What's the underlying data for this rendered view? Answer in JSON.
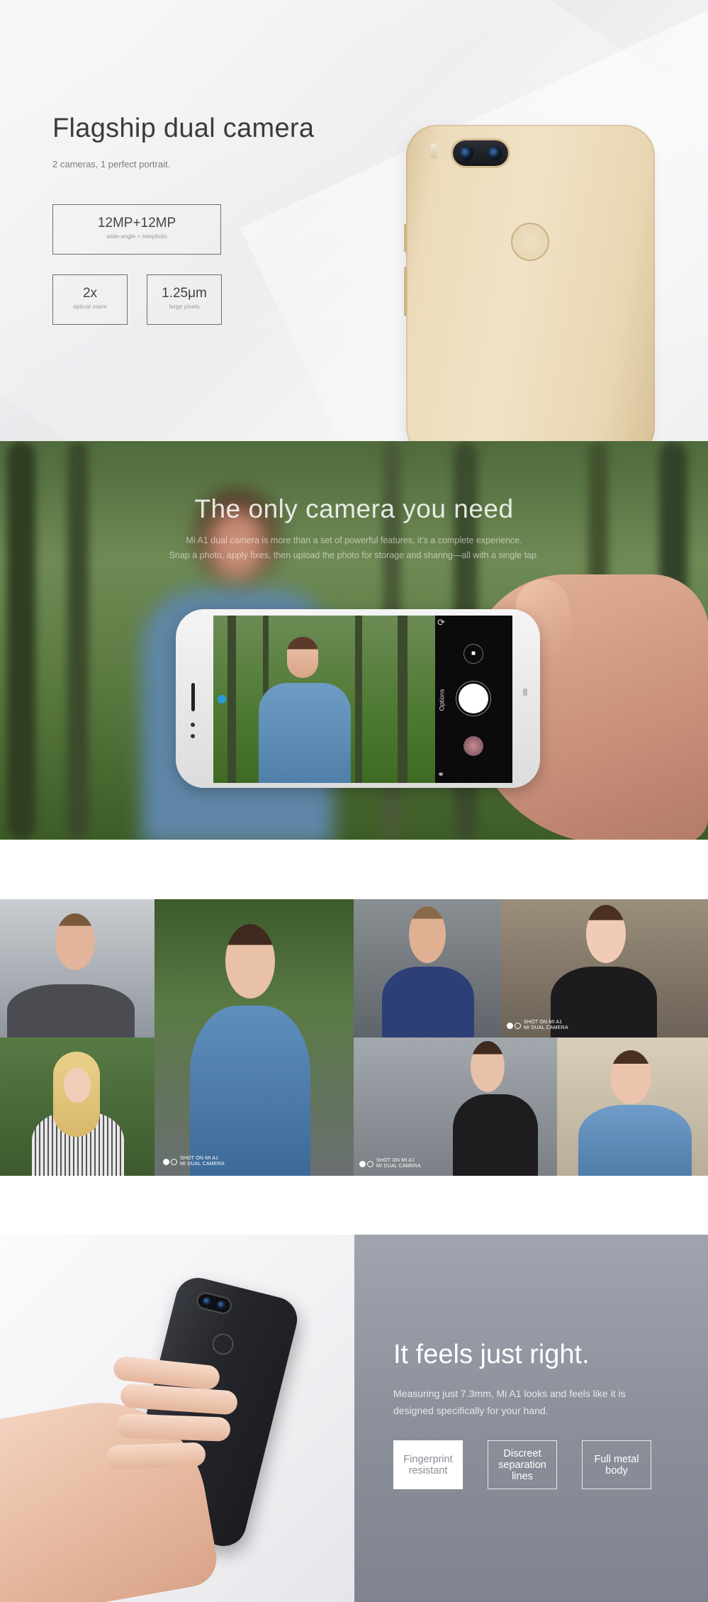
{
  "hero": {
    "title": "Flagship dual camera",
    "subtitle": "2 cameras, 1 perfect portrait.",
    "specs": [
      {
        "value": "12MP+12MP",
        "caption": "wide-angle + telephoto"
      },
      {
        "value": "2x",
        "caption": "optical zoom"
      },
      {
        "value": "1.25μm",
        "caption": "large pixels"
      }
    ]
  },
  "camera_section": {
    "title": "The only camera you need",
    "desc_line1": "Mi A1 dual camera is more than a set of powerful features, it's a complete experience.",
    "desc_line2": "Snap a photo, apply fixes, then upload the photo for storage and sharing—all with a single tap.",
    "camera_ui": {
      "options_label": "Options"
    }
  },
  "gallery": {
    "badges": [
      {
        "line1": "SHOT ON MI A1",
        "line2": "MI DUAL CAMERA"
      },
      {
        "line1": "SHOT ON MI A1",
        "line2": "MI DUAL CAMERA"
      },
      {
        "line1": "SHOT ON MI A1",
        "line2": "MI DUAL CAMERA"
      }
    ]
  },
  "feel": {
    "title": "It feels just right.",
    "desc": "Measuring just 7.3mm, Mi A1 looks and feels like it is designed specifically for your hand.",
    "features": [
      {
        "label": "Fingerprint resistant",
        "active": true
      },
      {
        "label": "Discreet separation lines",
        "active": false
      },
      {
        "label": "Full metal body",
        "active": false
      }
    ]
  },
  "colors": {
    "gold_phone": "#ecdcbb",
    "black_phone": "#25262b",
    "feel_panel": "#8c909b",
    "focus_accent": "#2a9bdc"
  },
  "icons": [
    "rotate-camera-icon",
    "video-mode-icon",
    "shutter-icon",
    "gallery-icon",
    "filter-icon",
    "focus-point-icon"
  ]
}
